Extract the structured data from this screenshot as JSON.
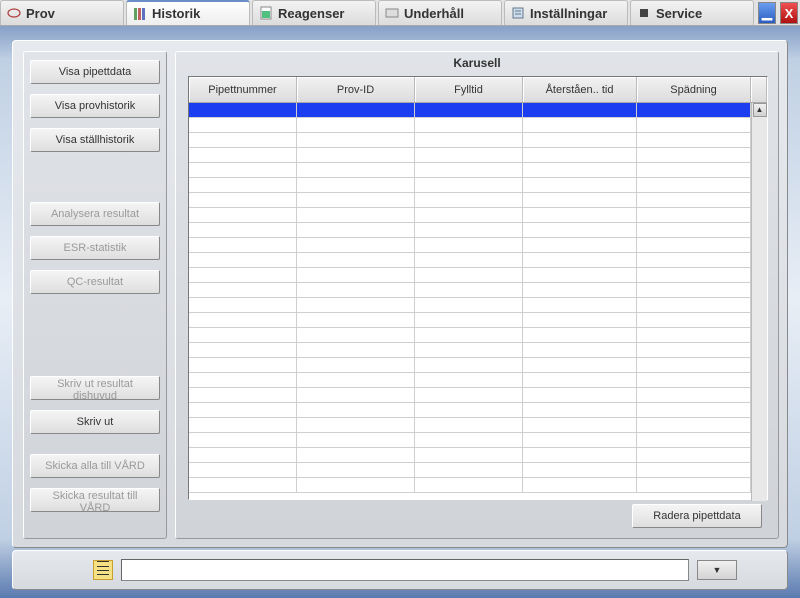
{
  "tabs": [
    {
      "label": "Prov"
    },
    {
      "label": "Historik"
    },
    {
      "label": "Reagenser"
    },
    {
      "label": "Underhåll"
    },
    {
      "label": "Inställningar"
    },
    {
      "label": "Service"
    }
  ],
  "active_tab_index": 1,
  "side_buttons": {
    "show_pipette": "Visa pipettdata",
    "show_sample_history": "Visa provhistorik",
    "show_rack_history": "Visa ställhistorik",
    "analyze_result": "Analysera resultat",
    "esr_stats": "ESR-statistik",
    "qc_result": "QC-resultat",
    "print_result_header": "Skriv ut resultat dishuvud",
    "print": "Skriv ut",
    "send_all_vard": "Skicka alla till VÅRD",
    "send_result_vard": "Skicka resultat till VÅRD"
  },
  "table": {
    "title": "Karusell",
    "columns": [
      "Pipettnummer",
      "Prov-ID",
      "Fylltid",
      "Återståen.. tid",
      "Spädning"
    ],
    "rows": [],
    "selected_row_index": 0
  },
  "delete_button": "Radera pipettdata",
  "status": {
    "value": ""
  }
}
